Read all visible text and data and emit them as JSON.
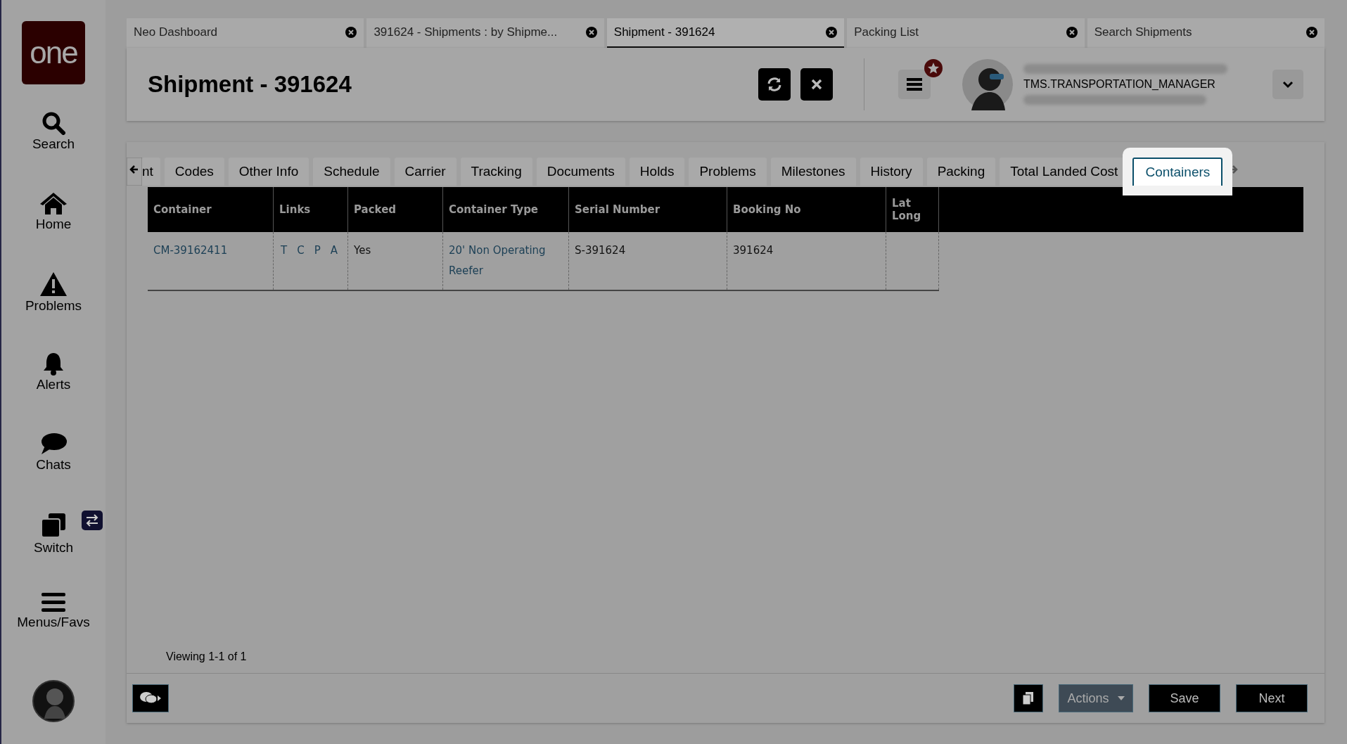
{
  "sidebar": {
    "logo": "one",
    "items": [
      {
        "label": "Search"
      },
      {
        "label": "Home"
      },
      {
        "label": "Problems"
      },
      {
        "label": "Alerts"
      },
      {
        "label": "Chats"
      },
      {
        "label": "Switch"
      },
      {
        "label": "Menus/Favs"
      }
    ]
  },
  "window_tabs": [
    {
      "label": "Neo Dashboard",
      "selected": false
    },
    {
      "label": "391624 - Shipments : by Shipme...",
      "selected": false
    },
    {
      "label": "Shipment - 391624",
      "selected": true
    },
    {
      "label": "Packing List",
      "selected": false
    },
    {
      "label": "Search Shipments",
      "selected": false
    }
  ],
  "header": {
    "title": "Shipment - 391624",
    "user_role": "TMS.TRANSPORTATION_MANAGER"
  },
  "section_tabs": [
    {
      "label": "nt",
      "selected": false
    },
    {
      "label": "Codes",
      "selected": false
    },
    {
      "label": "Other Info",
      "selected": false
    },
    {
      "label": "Schedule",
      "selected": false
    },
    {
      "label": "Carrier",
      "selected": false
    },
    {
      "label": "Tracking",
      "selected": false
    },
    {
      "label": "Documents",
      "selected": false
    },
    {
      "label": "Holds",
      "selected": false
    },
    {
      "label": "Problems",
      "selected": false
    },
    {
      "label": "Milestones",
      "selected": false
    },
    {
      "label": "History",
      "selected": false
    },
    {
      "label": "Packing",
      "selected": false
    },
    {
      "label": "Total Landed Cost",
      "selected": false
    },
    {
      "label": "Containers",
      "selected": true
    }
  ],
  "table": {
    "columns": [
      "Container",
      "Links",
      "Packed",
      "Container Type",
      "Serial Number",
      "Booking No",
      "Lat Long"
    ],
    "rows": [
      {
        "container": "CM-39162411",
        "links": [
          "T",
          "C",
          "P",
          "A"
        ],
        "packed": "Yes",
        "container_type": "20' Non Operating Reefer",
        "serial_number": "S-391624",
        "booking_no": "391624",
        "lat_long": ""
      }
    ]
  },
  "pager": "Viewing 1-1 of 1",
  "footer_buttons": [
    {
      "label": "Actions",
      "kind": "dropdown"
    },
    {
      "label": "Save",
      "kind": "primary"
    },
    {
      "label": "Next",
      "kind": "primary"
    }
  ]
}
